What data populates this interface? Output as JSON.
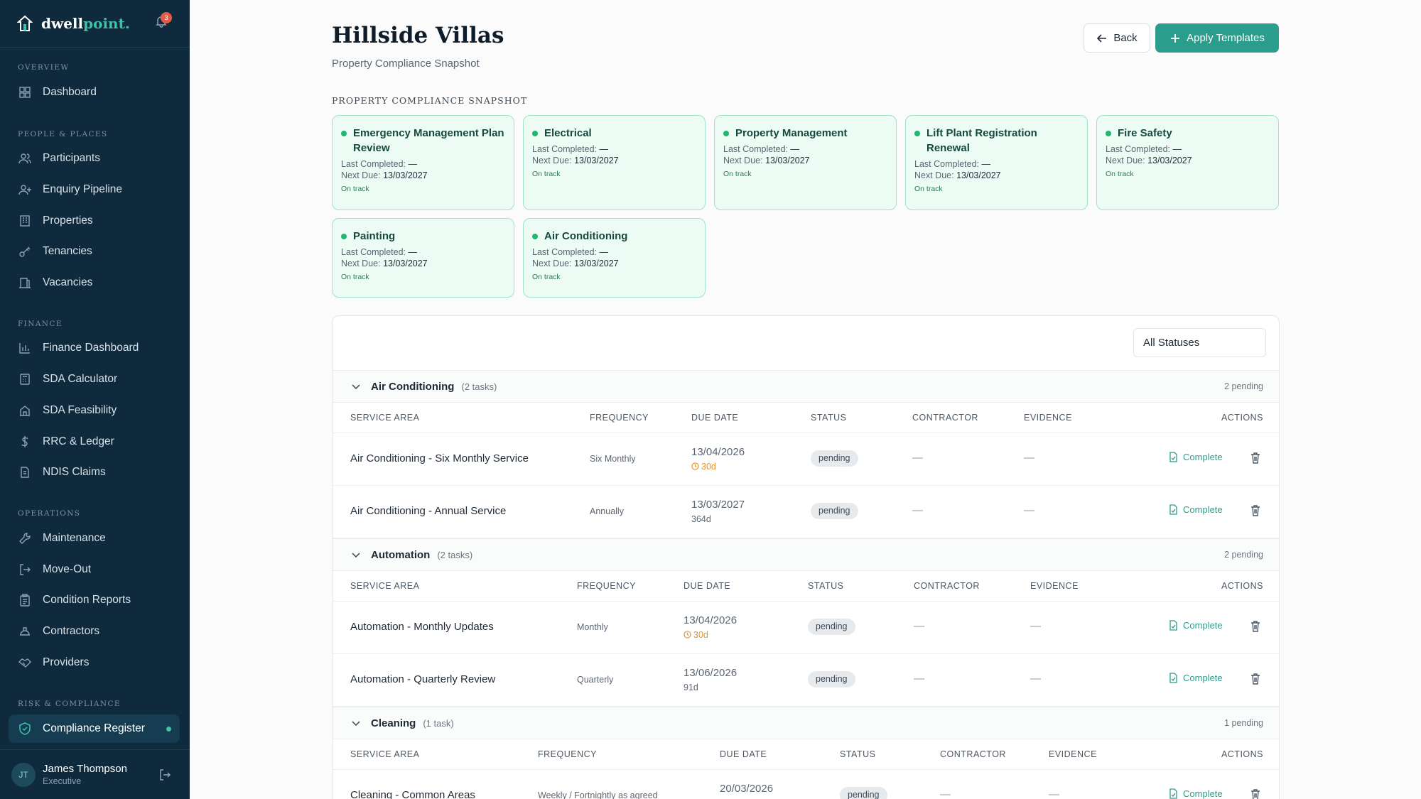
{
  "brand": {
    "name_a": "dwell",
    "name_b": "point.",
    "notif_count": "3"
  },
  "sidebar": {
    "sections": [
      "OVERVIEW",
      "PEOPLE & PLACES",
      "FINANCE",
      "OPERATIONS",
      "RISK & COMPLIANCE"
    ],
    "items": [
      {
        "label": "Dashboard",
        "icon": "dashboard-icon"
      },
      {
        "label": "Participants",
        "icon": "users-icon"
      },
      {
        "label": "Enquiry Pipeline",
        "icon": "user-plus-icon"
      },
      {
        "label": "Properties",
        "icon": "building-icon"
      },
      {
        "label": "Tenancies",
        "icon": "key-icon"
      },
      {
        "label": "Vacancies",
        "icon": "vacancy-icon"
      },
      {
        "label": "Finance Dashboard",
        "icon": "bar-chart-icon"
      },
      {
        "label": "SDA Calculator",
        "icon": "calculator-icon"
      },
      {
        "label": "SDA Feasibility",
        "icon": "feasibility-icon"
      },
      {
        "label": "RRC & Ledger",
        "icon": "dollar-icon"
      },
      {
        "label": "NDIS Claims",
        "icon": "document-icon"
      },
      {
        "label": "Maintenance",
        "icon": "wrench-icon"
      },
      {
        "label": "Move-Out",
        "icon": "exit-icon"
      },
      {
        "label": "Condition Reports",
        "icon": "clipboard-icon"
      },
      {
        "label": "Contractors",
        "icon": "hard-hat-icon"
      },
      {
        "label": "Providers",
        "icon": "handshake-icon"
      },
      {
        "label": "Compliance Register",
        "icon": "shield-icon"
      }
    ],
    "user": {
      "initials": "JT",
      "name": "James Thompson",
      "role": "Executive"
    }
  },
  "header": {
    "title": "Hillside Villas",
    "subtitle": "Property Compliance Snapshot",
    "back_label": "Back",
    "apply_label": "Apply Templates"
  },
  "snapshot": {
    "label": "PROPERTY COMPLIANCE SNAPSHOT",
    "cards": [
      {
        "title": "Emergency Management Plan Review",
        "last_label": "Last Completed:",
        "last": "—",
        "next_label": "Next Due:",
        "next": "13/03/2027",
        "status": "On track"
      },
      {
        "title": "Electrical",
        "last_label": "Last Completed:",
        "last": "—",
        "next_label": "Next Due:",
        "next": "13/03/2027",
        "status": "On track"
      },
      {
        "title": "Property Management",
        "last_label": "Last Completed:",
        "last": "—",
        "next_label": "Next Due:",
        "next": "13/03/2027",
        "status": "On track"
      },
      {
        "title": "Lift Plant Registration Renewal",
        "last_label": "Last Completed:",
        "last": "—",
        "next_label": "Next Due:",
        "next": "13/03/2027",
        "status": "On track"
      },
      {
        "title": "Fire Safety",
        "last_label": "Last Completed:",
        "last": "—",
        "next_label": "Next Due:",
        "next": "13/03/2027",
        "status": "On track"
      },
      {
        "title": "Painting",
        "last_label": "Last Completed:",
        "last": "—",
        "next_label": "Next Due:",
        "next": "13/03/2027",
        "status": "On track"
      },
      {
        "title": "Air Conditioning",
        "last_label": "Last Completed:",
        "last": "—",
        "next_label": "Next Due:",
        "next": "13/03/2027",
        "status": "On track"
      }
    ]
  },
  "filter": {
    "value": "All Statuses"
  },
  "columns": [
    "SERVICE AREA",
    "FREQUENCY",
    "DUE DATE",
    "STATUS",
    "CONTRACTOR",
    "EVIDENCE",
    "ACTIONS"
  ],
  "groups": [
    {
      "name": "Air Conditioning",
      "count": "(2 tasks)",
      "pending": "2 pending",
      "rows": [
        {
          "name": "Air Conditioning - Six Monthly Service",
          "freq": "Six Monthly",
          "due": "13/04/2026",
          "days": "30d",
          "warn": true,
          "status": "pending",
          "contractor": "—",
          "evidence": "—",
          "action": "Complete"
        },
        {
          "name": "Air Conditioning - Annual Service",
          "freq": "Annually",
          "due": "13/03/2027",
          "days": "364d",
          "warn": false,
          "status": "pending",
          "contractor": "—",
          "evidence": "—",
          "action": "Complete"
        }
      ]
    },
    {
      "name": "Automation",
      "count": "(2 tasks)",
      "pending": "2 pending",
      "rows": [
        {
          "name": "Automation - Monthly Updates",
          "freq": "Monthly",
          "due": "13/04/2026",
          "days": "30d",
          "warn": true,
          "status": "pending",
          "contractor": "—",
          "evidence": "—",
          "action": "Complete"
        },
        {
          "name": "Automation - Quarterly Review",
          "freq": "Quarterly",
          "due": "13/06/2026",
          "days": "91d",
          "warn": false,
          "status": "pending",
          "contractor": "—",
          "evidence": "—",
          "action": "Complete"
        }
      ]
    },
    {
      "name": "Cleaning",
      "count": "(1 task)",
      "pending": "1 pending",
      "rows": [
        {
          "name": "Cleaning - Common Areas",
          "freq": "Weekly / Fortnightly as agreed",
          "due": "20/03/2026",
          "days": "",
          "warn": true,
          "status": "pending",
          "contractor": "—",
          "evidence": "—",
          "action": "Complete"
        }
      ]
    }
  ],
  "colors": {
    "sidebar_bg": "#0f2a3d",
    "accent": "#2a9d8c",
    "card_bg": "#ecfbf4",
    "on_track": "#22b573",
    "warn": "#e09233"
  }
}
